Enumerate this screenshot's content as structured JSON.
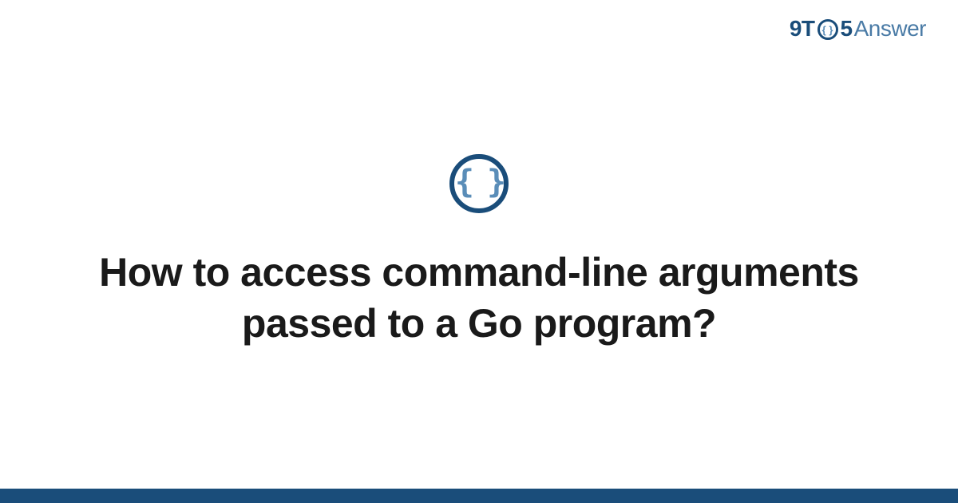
{
  "header": {
    "logo_9t": "9T",
    "logo_o_inner": "{ }",
    "logo_5": "5",
    "logo_answer": "Answer"
  },
  "main": {
    "icon_braces": "{ }",
    "title": "How to access command-line arguments passed to a Go program?"
  },
  "colors": {
    "brand_dark": "#1a4d7a",
    "brand_light": "#5a8db8",
    "text": "#1a1a1a"
  }
}
